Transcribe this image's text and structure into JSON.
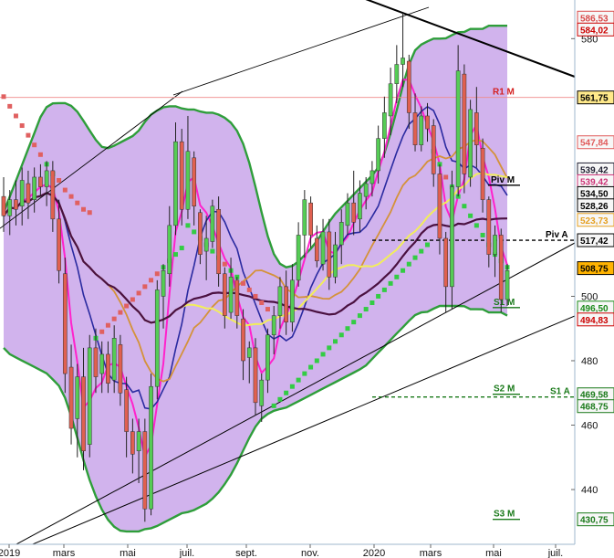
{
  "chart_data": {
    "type": "candlestick",
    "ylim": [
      423,
      592
    ],
    "x_axis": {
      "labels": [
        "2019",
        "mars",
        "mai",
        "juil.",
        "sept.",
        "nov.",
        "2020",
        "mars",
        "mai",
        "juil."
      ]
    },
    "y_axis": {
      "ticks": [
        580,
        500,
        480,
        460,
        440
      ]
    },
    "price_tags": [
      {
        "value": 586.53,
        "label": "586,53",
        "color": "#d94a4a"
      },
      {
        "value": 584.02,
        "label": "584,02",
        "color": "#cc0000"
      },
      {
        "value": 561.75,
        "label": "561,75",
        "color": "#000000",
        "fill": "#ffe98a"
      },
      {
        "value": 547.84,
        "label": "547,84",
        "color": "#e05a5a"
      },
      {
        "value": 539.42,
        "label": "539,42",
        "color": "#223"
      },
      {
        "value": 539.42,
        "label": "539,42",
        "color": "#cc3377"
      },
      {
        "value": 534.5,
        "label": "534,50",
        "color": "#000000"
      },
      {
        "value": 528.26,
        "label": "528,26",
        "color": "#000000"
      },
      {
        "value": 523.73,
        "label": "523,73",
        "color": "#e6a020"
      },
      {
        "value": 517.42,
        "label": "517,42",
        "color": "#000000"
      },
      {
        "value": 508.75,
        "label": "508,75",
        "color": "#000000",
        "fill": "#ffb300"
      },
      {
        "value": 496.5,
        "label": "496,50",
        "color": "#1a8a1a"
      },
      {
        "value": 494.83,
        "label": "494,83",
        "color": "#cc0000"
      },
      {
        "value": 469.58,
        "label": "469,58",
        "color": "#1a7a1a"
      },
      {
        "value": 468.75,
        "label": "468,75",
        "color": "#1a7a1a"
      },
      {
        "value": 430.75,
        "label": "430,75",
        "color": "#1a7a1a"
      }
    ],
    "pivot_levels": [
      {
        "label": "R1 M",
        "value": 561.75,
        "color": "#d42020",
        "style": "solid-thin"
      },
      {
        "label": "Piv M",
        "value": 534.5,
        "color": "#000000",
        "style": "solid"
      },
      {
        "label": "Piv A",
        "value": 517.42,
        "color": "#000000",
        "style": "dashed"
      },
      {
        "label": "S1 M",
        "value": 496.5,
        "color": "#1a7a1a",
        "style": "solid"
      },
      {
        "label": "S2 M",
        "value": 469.58,
        "color": "#1a7a1a",
        "style": "solid"
      },
      {
        "label": "S1 A",
        "value": 468.75,
        "color": "#1a7a1a",
        "style": "dashed"
      },
      {
        "label": "S3 M",
        "value": 430.75,
        "color": "#1a7a1a",
        "style": "solid"
      }
    ],
    "series": [
      {
        "name": "",
        "values": [
          {
            "o": 531,
            "h": 537,
            "l": 520,
            "c": 525
          },
          {
            "o": 525,
            "h": 533,
            "l": 519,
            "c": 530
          },
          {
            "o": 530,
            "h": 536,
            "l": 522,
            "c": 527
          },
          {
            "o": 528,
            "h": 540,
            "l": 522,
            "c": 536
          },
          {
            "o": 535,
            "h": 539,
            "l": 524,
            "c": 529
          },
          {
            "o": 530,
            "h": 540,
            "l": 526,
            "c": 537
          },
          {
            "o": 537,
            "h": 541,
            "l": 531,
            "c": 534
          },
          {
            "o": 534,
            "h": 542,
            "l": 528,
            "c": 539
          },
          {
            "o": 539,
            "h": 542,
            "l": 520,
            "c": 524
          },
          {
            "o": 524,
            "h": 530,
            "l": 504,
            "c": 508
          },
          {
            "o": 507,
            "h": 512,
            "l": 470,
            "c": 476
          },
          {
            "o": 478,
            "h": 485,
            "l": 454,
            "c": 459
          },
          {
            "o": 462,
            "h": 479,
            "l": 450,
            "c": 475
          },
          {
            "o": 475,
            "h": 484,
            "l": 446,
            "c": 452
          },
          {
            "o": 454,
            "h": 488,
            "l": 450,
            "c": 484
          },
          {
            "o": 484,
            "h": 490,
            "l": 470,
            "c": 475
          },
          {
            "o": 476,
            "h": 486,
            "l": 470,
            "c": 482
          },
          {
            "o": 482,
            "h": 486,
            "l": 470,
            "c": 473
          },
          {
            "o": 474,
            "h": 491,
            "l": 470,
            "c": 487
          },
          {
            "o": 485,
            "h": 488,
            "l": 466,
            "c": 470
          },
          {
            "o": 471,
            "h": 475,
            "l": 450,
            "c": 458
          },
          {
            "o": 458,
            "h": 462,
            "l": 445,
            "c": 451
          },
          {
            "o": 452,
            "h": 462,
            "l": 442,
            "c": 458
          },
          {
            "o": 458,
            "h": 462,
            "l": 430,
            "c": 434
          },
          {
            "o": 434,
            "h": 476,
            "l": 432,
            "c": 472
          },
          {
            "o": 472,
            "h": 505,
            "l": 468,
            "c": 502
          },
          {
            "o": 500,
            "h": 510,
            "l": 490,
            "c": 508
          },
          {
            "o": 507,
            "h": 528,
            "l": 503,
            "c": 522
          },
          {
            "o": 522,
            "h": 554,
            "l": 519,
            "c": 548
          },
          {
            "o": 548,
            "h": 552,
            "l": 522,
            "c": 527
          },
          {
            "o": 527,
            "h": 556,
            "l": 524,
            "c": 545
          },
          {
            "o": 543,
            "h": 545,
            "l": 522,
            "c": 528
          },
          {
            "o": 526,
            "h": 527,
            "l": 510,
            "c": 513
          },
          {
            "o": 514,
            "h": 525,
            "l": 505,
            "c": 518
          },
          {
            "o": 517,
            "h": 530,
            "l": 515,
            "c": 528
          },
          {
            "o": 527,
            "h": 531,
            "l": 503,
            "c": 507
          },
          {
            "o": 507,
            "h": 509,
            "l": 490,
            "c": 494
          },
          {
            "o": 495,
            "h": 512,
            "l": 493,
            "c": 506
          },
          {
            "o": 505,
            "h": 506,
            "l": 490,
            "c": 494
          },
          {
            "o": 493,
            "h": 496,
            "l": 474,
            "c": 480
          },
          {
            "o": 481,
            "h": 486,
            "l": 473,
            "c": 484
          },
          {
            "o": 484,
            "h": 487,
            "l": 463,
            "c": 467
          },
          {
            "o": 466,
            "h": 476,
            "l": 461,
            "c": 474
          },
          {
            "o": 474,
            "h": 490,
            "l": 470,
            "c": 488
          },
          {
            "o": 488,
            "h": 497,
            "l": 482,
            "c": 494
          },
          {
            "o": 494,
            "h": 506,
            "l": 490,
            "c": 503
          },
          {
            "o": 503,
            "h": 508,
            "l": 488,
            "c": 492
          },
          {
            "o": 492,
            "h": 510,
            "l": 489,
            "c": 505
          },
          {
            "o": 505,
            "h": 523,
            "l": 503,
            "c": 519
          },
          {
            "o": 519,
            "h": 533,
            "l": 512,
            "c": 530
          },
          {
            "o": 529,
            "h": 531,
            "l": 515,
            "c": 519
          },
          {
            "o": 518,
            "h": 522,
            "l": 509,
            "c": 511
          },
          {
            "o": 510,
            "h": 524,
            "l": 508,
            "c": 520
          },
          {
            "o": 520,
            "h": 524,
            "l": 502,
            "c": 506
          },
          {
            "o": 506,
            "h": 520,
            "l": 504,
            "c": 516
          },
          {
            "o": 516,
            "h": 527,
            "l": 510,
            "c": 523
          },
          {
            "o": 522,
            "h": 532,
            "l": 519,
            "c": 529
          },
          {
            "o": 529,
            "h": 539,
            "l": 519,
            "c": 523
          },
          {
            "o": 524,
            "h": 536,
            "l": 520,
            "c": 532
          },
          {
            "o": 531,
            "h": 537,
            "l": 527,
            "c": 535
          },
          {
            "o": 535,
            "h": 542,
            "l": 531,
            "c": 539
          },
          {
            "o": 539,
            "h": 553,
            "l": 535,
            "c": 549
          },
          {
            "o": 549,
            "h": 562,
            "l": 543,
            "c": 557
          },
          {
            "o": 556,
            "h": 571,
            "l": 550,
            "c": 566
          },
          {
            "o": 566,
            "h": 578,
            "l": 560,
            "c": 572
          },
          {
            "o": 572,
            "h": 588,
            "l": 565,
            "c": 574
          },
          {
            "o": 573,
            "h": 575,
            "l": 552,
            "c": 557
          },
          {
            "o": 557,
            "h": 563,
            "l": 545,
            "c": 547
          },
          {
            "o": 547,
            "h": 559,
            "l": 545,
            "c": 556
          },
          {
            "o": 556,
            "h": 560,
            "l": 548,
            "c": 552
          },
          {
            "o": 553,
            "h": 555,
            "l": 534,
            "c": 538
          },
          {
            "o": 538,
            "h": 541,
            "l": 513,
            "c": 518
          },
          {
            "o": 518,
            "h": 520,
            "l": 495,
            "c": 503
          },
          {
            "o": 503,
            "h": 539,
            "l": 496,
            "c": 534
          },
          {
            "o": 534,
            "h": 578,
            "l": 531,
            "c": 570
          },
          {
            "o": 569,
            "h": 572,
            "l": 532,
            "c": 538
          },
          {
            "o": 537,
            "h": 561,
            "l": 534,
            "c": 558
          },
          {
            "o": 557,
            "h": 565,
            "l": 540,
            "c": 547
          },
          {
            "o": 546,
            "h": 549,
            "l": 526,
            "c": 530
          },
          {
            "o": 530,
            "h": 531,
            "l": 509,
            "c": 513
          },
          {
            "o": 513,
            "h": 522,
            "l": 506,
            "c": 519
          },
          {
            "o": 519,
            "h": 521,
            "l": 495,
            "c": 499
          },
          {
            "o": 499,
            "h": 510,
            "l": 497,
            "c": 508
          }
        ]
      }
    ],
    "sar_points": [
      562,
      559,
      556,
      553,
      550,
      547,
      544,
      541,
      538,
      536,
      533,
      531,
      529,
      527,
      526,
      487,
      489,
      491,
      493,
      495,
      497,
      499,
      501,
      503,
      505,
      507,
      509,
      511,
      513,
      515,
      522,
      520,
      518,
      516,
      514,
      512,
      510,
      508,
      506,
      504,
      502,
      500,
      498,
      496,
      466,
      468,
      470,
      472,
      474,
      476,
      478,
      480,
      482,
      484,
      486,
      488,
      490,
      492,
      494,
      496,
      498,
      500,
      502,
      504,
      506,
      508,
      510,
      512,
      514,
      516,
      545,
      541,
      537,
      534,
      531,
      528,
      525,
      522,
      519,
      516,
      513,
      511,
      509
    ],
    "bollinger": {
      "upper": [
        526,
        531,
        536,
        541,
        546,
        551,
        556,
        559,
        560,
        560,
        560,
        559,
        557,
        554,
        551,
        548,
        546,
        546,
        547,
        548,
        549,
        550,
        552,
        555,
        557,
        558,
        559,
        559,
        559,
        558,
        558,
        558,
        557,
        557,
        557,
        556,
        555,
        553,
        550,
        545,
        538,
        530,
        522,
        515,
        511,
        509,
        509,
        510,
        512,
        514,
        516,
        519,
        522,
        525,
        527,
        529,
        531,
        533,
        535,
        537,
        539,
        543,
        549,
        556,
        564,
        571,
        576,
        578,
        579,
        580,
        580,
        580,
        581,
        582,
        582,
        583,
        583,
        583,
        584,
        584,
        584,
        584
      ],
      "lower": [
        484,
        482,
        481,
        480,
        479,
        478,
        477,
        476,
        474,
        472,
        468,
        462,
        455,
        448,
        442,
        437,
        433,
        430,
        428,
        427,
        427,
        427,
        427,
        428,
        428,
        429,
        430,
        431,
        432,
        433,
        433,
        434,
        435,
        436,
        438,
        440,
        443,
        446,
        450,
        454,
        458,
        461,
        463,
        464,
        465,
        465,
        466,
        467,
        468,
        469,
        470,
        471,
        472,
        473,
        474,
        475,
        476,
        477,
        478,
        480,
        482,
        484,
        486,
        488,
        490,
        492,
        494,
        495,
        495,
        496,
        497,
        497,
        497,
        497,
        497,
        496,
        496,
        496,
        495,
        495,
        495,
        494
      ]
    }
  }
}
